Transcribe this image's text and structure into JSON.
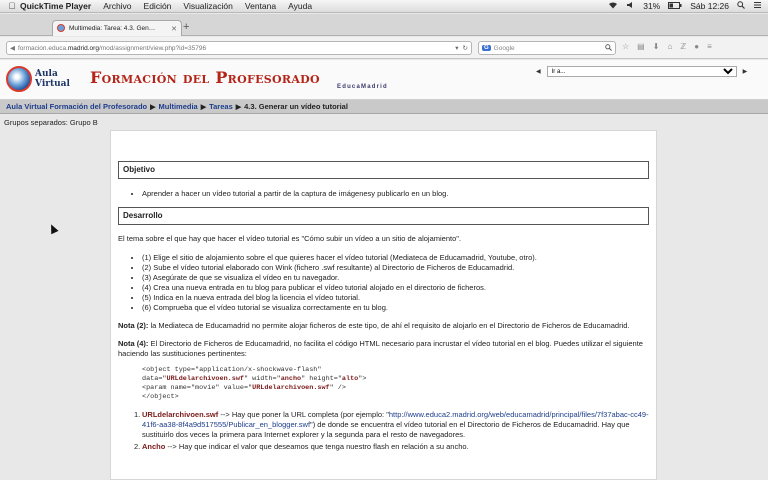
{
  "menubar": {
    "apple": "",
    "app": "QuickTime Player",
    "items": [
      "Archivo",
      "Edición",
      "Visualización",
      "Ventana",
      "Ayuda"
    ],
    "battery": "31%",
    "clock": "Sáb 12:26"
  },
  "browser": {
    "tab_title": "Multimedia: Tarea: 4.3. Gen…",
    "url_host": "formacion.educa.madrid.org",
    "url_path": "/mod/assignment/view.php?id=35796",
    "url_scheme": "formacion.educa.",
    "url_domain": "madrid.org",
    "search_placeholder": "Google"
  },
  "site": {
    "aula_line1": "Aula",
    "aula_line2": "Virtual",
    "banner": "Formación del Profesorado",
    "edu": "EducaMadrid",
    "jump_placeholder": "Ir a..."
  },
  "breadcrumb": [
    "Aula Virtual Formación del Profesorado",
    "Multimedia",
    "Tareas",
    "4.3. Generar un vídeo tutorial"
  ],
  "groups_text": "Grupos separados: Grupo B",
  "content": {
    "objetivo_title": "Objetivo",
    "objetivo_item": "Aprender a hacer un vídeo tutorial a partir de la captura de imágenesy publicarlo en un blog.",
    "desarrollo_title": "Desarrollo",
    "intro": "El tema sobre el que hay que hacer el vídeo tutorial es \"Cómo subir un vídeo a un sitio de alojamiento\".",
    "steps": [
      "(1) Elige el sitio de alojamiento sobre el que quieres hacer el vídeo tutorial (Mediateca de Educamadrid, Youtube, otro).",
      "(2) Sube el vídeo tutorial elaborado con Wink (fichero .swf resultante) al Directorio de Ficheros de Educamadrid.",
      "(3) Asegúrate de que se visualiza el vídeo en tu navegador.",
      "(4) Crea una nueva entrada en tu blog para publicar el vídeo tutorial alojado en el directorio de ficheros.",
      "(5) Indica en la nueva entrada del blog la licencia el vídeo tutorial.",
      "(6) Comprueba que el vídeo tutorial se visualiza correctamente en tu blog."
    ],
    "nota2_label": "Nota (2):",
    "nota2_text": " la Mediateca de Educamadrid no permite alojar ficheros de este tipo, de ahí el requisito de alojarlo en el Directorio de Ficheros de Educamadrid.",
    "nota4_label": "Nota (4):",
    "nota4_text": " El Directorio de Ficheros de Educamadrid, no facilita el código HTML necesario para incrustar el vídeo tutorial en el blog. Puedes utilizar el siguiente haciendo las sustituciones pertinentes:",
    "code_l1": "<object type=\"application/x-shockwave-flash\"",
    "code_l2a": "data=\"",
    "code_l2b": "URLdelarchivoen.swf",
    "code_l2c": "\" width=\"",
    "code_l2d": "ancho",
    "code_l2e": "\" height=\"",
    "code_l2f": "alto",
    "code_l2g": "\">",
    "code_l3a": "<param name=\"movie\" value=\"",
    "code_l3b": "URLdelarchivoen.swf",
    "code_l3c": "\" />",
    "code_l4": "</object>",
    "note1_num": "1.",
    "note1_key": "URLdelarchivoen.swf",
    "note1_text_a": " --> Hay que poner la URL completa (por ejemplo: \"",
    "note1_link": "http://www.educa2.madrid.org/web/educamadrid/principal/files/7f37abac-cc49-41f6-aa38-8f4a9d517555/Publicar_en_blogger.swf",
    "note1_text_b": "\") de donde se encuentra el vídeo tutorial en el Directorio de Ficheros de Educamadrid. Hay que sustituirlo dos veces la primera para Internet explorer y la segunda para el resto de navegadores.",
    "note2_num": "2.",
    "note2_key": "Ancho",
    "note2_text": " --> Hay que indicar el valor que deseamos que tenga nuestro flash en relación a su ancho."
  }
}
